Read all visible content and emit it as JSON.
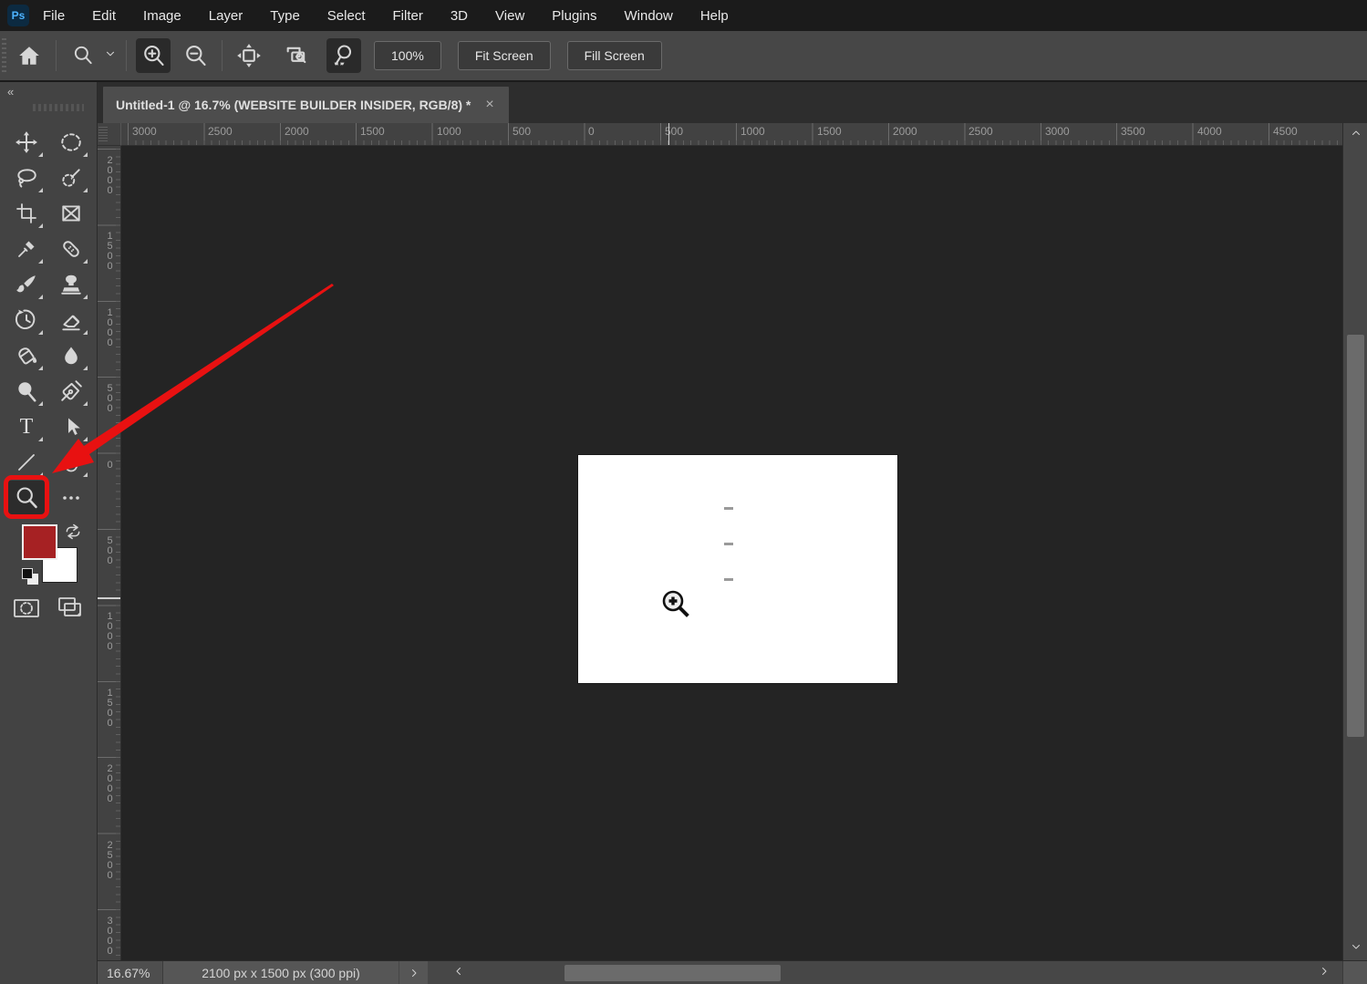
{
  "menubar": {
    "logo": "Ps",
    "items": [
      "File",
      "Edit",
      "Image",
      "Layer",
      "Type",
      "Select",
      "Filter",
      "3D",
      "View",
      "Plugins",
      "Window",
      "Help"
    ]
  },
  "options_bar": {
    "zoom_level": "100%",
    "fit_screen_label": "Fit Screen",
    "fill_screen_label": "Fill Screen",
    "icons": [
      "home",
      "zoom-tool-preset",
      "zoom-in",
      "zoom-out",
      "resize-windows-to-fit",
      "zoom-all-windows",
      "scrubby-zoom"
    ],
    "pressed_icons": [
      "zoom-in",
      "scrubby-zoom"
    ]
  },
  "tab_bar": {
    "collapse_icon": "«",
    "active_tab": {
      "title": "Untitled-1 @ 16.7% (WEBSITE BUILDER INSIDER, RGB/8) *",
      "close": "×"
    }
  },
  "toolbar": {
    "tools": [
      "move",
      "marquee",
      "lasso",
      "quick-selection",
      "crop",
      "frame",
      "eyedropper",
      "healing-brush",
      "brush",
      "clone-stamp",
      "history-brush",
      "eraser",
      "paint-bucket",
      "blur",
      "dodge",
      "pen",
      "type",
      "path-selection",
      "line",
      "hand",
      "zoom",
      "edit-toolbar"
    ],
    "selected_tool": "zoom",
    "type_glyph": "T",
    "foreground_color": "#a62123",
    "background_color": "#ffffff"
  },
  "rulers": {
    "horizontal": [
      "3000",
      "2500",
      "2000",
      "1500",
      "1000",
      "500",
      "0",
      "500",
      "1000",
      "1500",
      "2000",
      "2500",
      "3000",
      "3500",
      "4000",
      "4500"
    ],
    "vertical": [
      "2000",
      "1500",
      "1000",
      "500",
      "0",
      "500",
      "1000",
      "1500",
      "2000",
      "2500",
      "3000"
    ]
  },
  "annotation": {
    "arrow_color": "#e81111",
    "highlight_color": "#e81111"
  },
  "status_bar": {
    "zoom": "16.67%",
    "doc_info": "2100 px x 1500 px (300 ppi)"
  }
}
